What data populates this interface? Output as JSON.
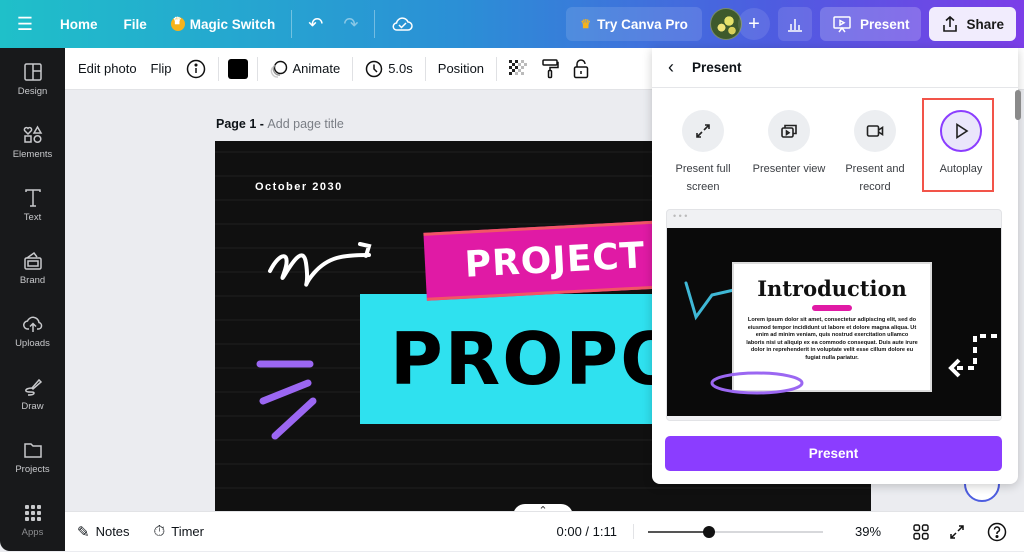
{
  "topbar": {
    "menu_icon": "hamburger-icon",
    "home": "Home",
    "file": "File",
    "magic_switch": "Magic Switch",
    "undo_icon": "undo-icon",
    "redo_icon": "redo-icon",
    "cloud_icon": "cloud-saved-icon",
    "try_pro": "Try Canva Pro",
    "add_collaborator": "+",
    "stats_icon": "insights-icon",
    "present": "Present",
    "share": "Share"
  },
  "sidebar": {
    "items": [
      {
        "label": "Design",
        "icon": "layout-icon"
      },
      {
        "label": "Elements",
        "icon": "shapes-icon"
      },
      {
        "label": "Text",
        "icon": "text-icon"
      },
      {
        "label": "Brand",
        "icon": "brand-icon"
      },
      {
        "label": "Uploads",
        "icon": "upload-cloud-icon"
      },
      {
        "label": "Draw",
        "icon": "draw-icon"
      },
      {
        "label": "Projects",
        "icon": "folder-icon"
      },
      {
        "label": "Apps",
        "icon": "apps-grid-icon"
      }
    ]
  },
  "toolbar": {
    "edit_photo": "Edit photo",
    "flip": "Flip",
    "info_icon": "info-icon",
    "color": "#000000",
    "animate": "Animate",
    "duration": "5.0s",
    "position": "Position",
    "transparency_icon": "transparency-icon",
    "paint_icon": "copy-style-icon",
    "lock_icon": "lock-icon"
  },
  "canvas": {
    "page_label": "Page 1 - ",
    "page_title_placeholder": "Add page title",
    "slide": {
      "date": "October 2030",
      "title_top": "PROJECT",
      "title_main": "PROPOS"
    }
  },
  "present_panel": {
    "title": "Present",
    "options": [
      {
        "label": "Present full screen",
        "icon": "expand-icon",
        "selected": false
      },
      {
        "label": "Presenter view",
        "icon": "presenter-view-icon",
        "selected": false
      },
      {
        "label": "Present and record",
        "icon": "video-camera-icon",
        "selected": false
      },
      {
        "label": "Autoplay",
        "icon": "play-icon",
        "selected": true
      }
    ],
    "preview": {
      "heading": "Introduction",
      "body": "Lorem ipsum dolor sit amet, consectetur adipiscing elit, sed do eiusmod tempor incididunt ut labore et dolore magna aliqua. Ut enim ad minim veniam, quis nostrud exercitation ullamco laboris nisi ut aliquip ex ea commodo consequat. Duis aute irure dolor in reprehenderit in voluptate velit esse cillum dolore eu fugiat nulla pariatur."
    },
    "present_button": "Present"
  },
  "statusbar": {
    "notes": "Notes",
    "timer": "Timer",
    "time": "0:00 / 1:11",
    "zoom_fraction": 0.35,
    "zoom_label": "39%"
  },
  "colors": {
    "accent": "#8b3dff",
    "highlight": "#f25449",
    "slide_pink": "#e01aa5",
    "slide_cyan": "#2fe1ef"
  }
}
